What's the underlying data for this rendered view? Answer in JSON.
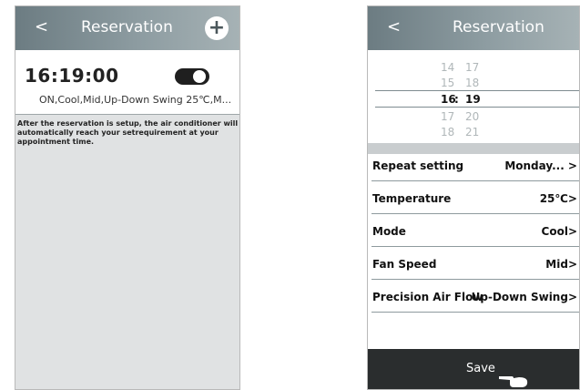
{
  "left": {
    "header": {
      "back": "<",
      "title": "Reservation",
      "add": "+"
    },
    "reservation": {
      "time": "16:19:00",
      "toggle_on": true,
      "summary": "ON,Cool,Mid,Up-Down Swing 25℃,M..."
    },
    "note": "After the reservation is setup, the air conditioner will automatically reach your setrequirement at your appointment time."
  },
  "right": {
    "header": {
      "back": "<",
      "title": "Reservation"
    },
    "picker": {
      "rows": [
        {
          "hour": "14",
          "minute": "17"
        },
        {
          "hour": "15",
          "minute": "18"
        },
        {
          "hour": "16",
          "minute": "19"
        },
        {
          "hour": "17",
          "minute": "20"
        },
        {
          "hour": "18",
          "minute": "21"
        }
      ],
      "colon": ":"
    },
    "settings": [
      {
        "label": "Repeat setting",
        "value": "Monday... >"
      },
      {
        "label": "Temperature",
        "value": "25℃>"
      },
      {
        "label": "Mode",
        "value": "Cool>"
      },
      {
        "label": "Fan Speed",
        "value": "Mid>"
      },
      {
        "label": "Precision Air Flow",
        "value": "Up-Down Swing>"
      }
    ],
    "save_label": "Save"
  },
  "colors": {
    "header": "#7f8f94",
    "save_bar": "#2a2d2e",
    "panel_bg": "#e0e2e3"
  }
}
